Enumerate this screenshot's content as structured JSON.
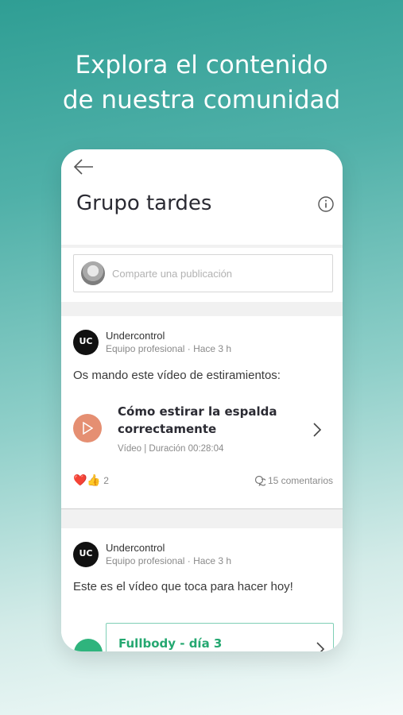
{
  "headline": {
    "line1": "Explora el contenido",
    "line2": "de nuestra comunidad"
  },
  "app": {
    "back_icon": "arrow-left-icon",
    "title": "Grupo tardes",
    "info_icon": "info-icon"
  },
  "composer": {
    "placeholder": "Comparte una publicación"
  },
  "posts": [
    {
      "author": "Undercontrol",
      "avatar_text": "UC",
      "meta": "Equipo profesional · Hace 3 h",
      "text": "Os mando este vídeo de estiramientos:",
      "video": {
        "title": "Cómo estirar la espalda correctamente",
        "meta": "Vídeo | Duración 00:28:04",
        "accent": "#e58f72"
      },
      "reactions": {
        "emojis": "❤️👍",
        "count": "2"
      },
      "comments": "15 comentarios"
    },
    {
      "author": "Undercontrol",
      "avatar_text": "UC",
      "meta": "Equipo profesional · Hace 3 h",
      "text": "Este es el vídeo que toca para hacer hoy!",
      "video": {
        "title": "Fullbody - día 3",
        "accent": "#2fb47d"
      }
    }
  ],
  "colors": {
    "bg_top": "#2f9e94",
    "bg_bottom": "#f4fbfa",
    "accent_green": "#25a871"
  }
}
